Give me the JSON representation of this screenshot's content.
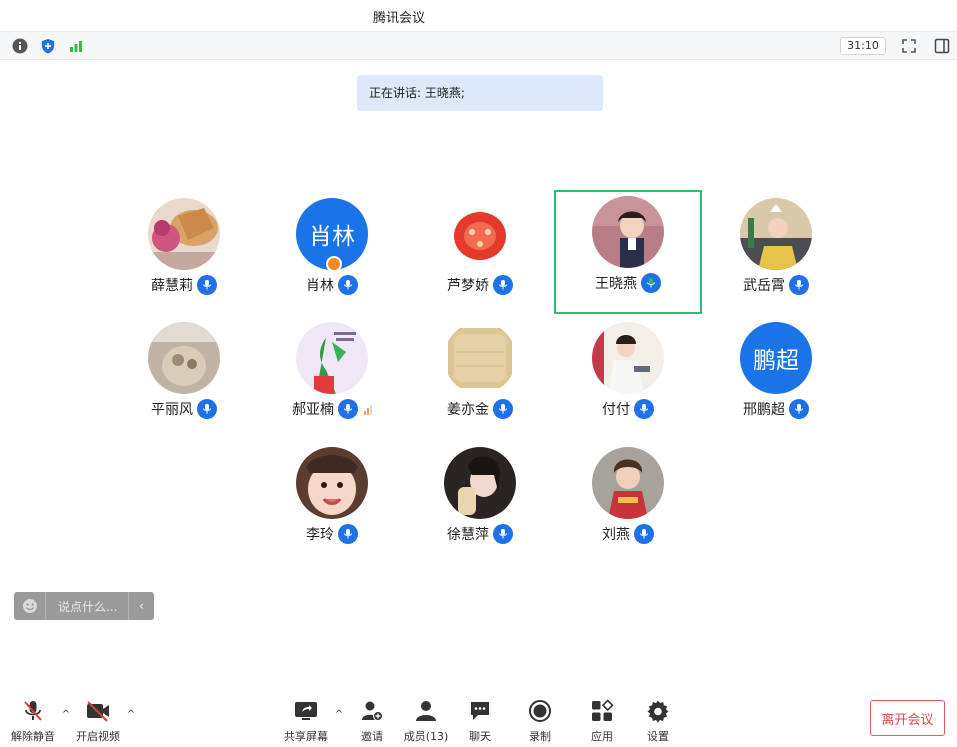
{
  "window": {
    "title": "腾讯会议"
  },
  "infobar": {
    "timer": "31:10",
    "icons": [
      "info-icon",
      "shield-icon",
      "signal-icon",
      "fullscreen-icon",
      "sidebar-toggle-icon"
    ]
  },
  "speaking": {
    "text": "正在讲话: 王晓燕;"
  },
  "participants": [
    {
      "name": "薛慧莉",
      "avatar": "photo"
    },
    {
      "name": "肖林",
      "avatar_text": "肖林",
      "host": true
    },
    {
      "name": "芦梦娇",
      "avatar": "photo"
    },
    {
      "name": "王晓燕",
      "avatar": "photo",
      "speaking": true
    },
    {
      "name": "武岳霄",
      "avatar": "photo"
    },
    {
      "name": "平丽风",
      "avatar": "photo"
    },
    {
      "name": "郝亚楠",
      "avatar": "photo"
    },
    {
      "name": "姜亦金",
      "avatar": "photo"
    },
    {
      "name": "付付",
      "avatar": "photo"
    },
    {
      "name": "邢鹏超",
      "avatar_text": "鹏超"
    },
    {
      "name": "李玲",
      "avatar": "photo"
    },
    {
      "name": "徐慧萍",
      "avatar": "photo"
    },
    {
      "name": "刘燕",
      "avatar": "photo"
    }
  ],
  "chat": {
    "placeholder": "说点什么...",
    "collapse": "‹"
  },
  "toolbar": {
    "unmute": "解除静音",
    "start_video": "开启视频",
    "share_screen": "共享屏幕",
    "invite": "邀请",
    "members": "成员(13)",
    "chat": "聊天",
    "record": "录制",
    "apps": "应用",
    "settings": "设置",
    "leave": "离开会议",
    "caret": "^"
  },
  "colors": {
    "accent": "#1e72e8",
    "active_border": "#2fbf71",
    "leave": "#e04848",
    "speaking_bg": "#dde9fb"
  }
}
